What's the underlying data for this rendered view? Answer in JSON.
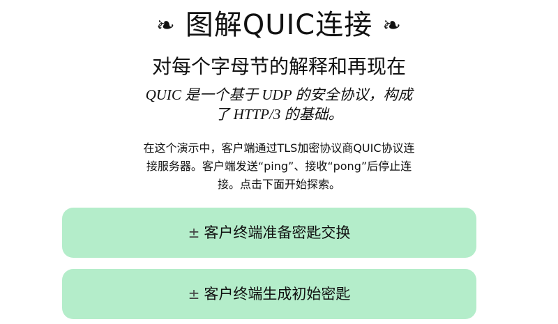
{
  "header": {
    "ornament_left": "❧",
    "title": "图解QUIC连接",
    "ornament_right": "❧",
    "subtitle": "对每个字母节的解释和再现在"
  },
  "intro": {
    "tagline": "QUIC 是一个基于 UDP 的安全协议，构成了 HTTP/3 的基础。",
    "description": "在这个演示中，客户端通过TLS加密协议商QUIC协议连接服务器。客户端发送“ping”、接收“pong”后停止连接。点击下面开始探索。"
  },
  "steps": [
    {
      "toggle": "±",
      "label": "客户终端准备密匙交换"
    },
    {
      "toggle": "±",
      "label": "客户终端生成初始密匙"
    }
  ],
  "colors": {
    "step_background": "#b4edca",
    "text": "#111111"
  },
  "icons": {
    "ornament": "floral-heart-icon",
    "toggle": "plus-minus-icon"
  }
}
